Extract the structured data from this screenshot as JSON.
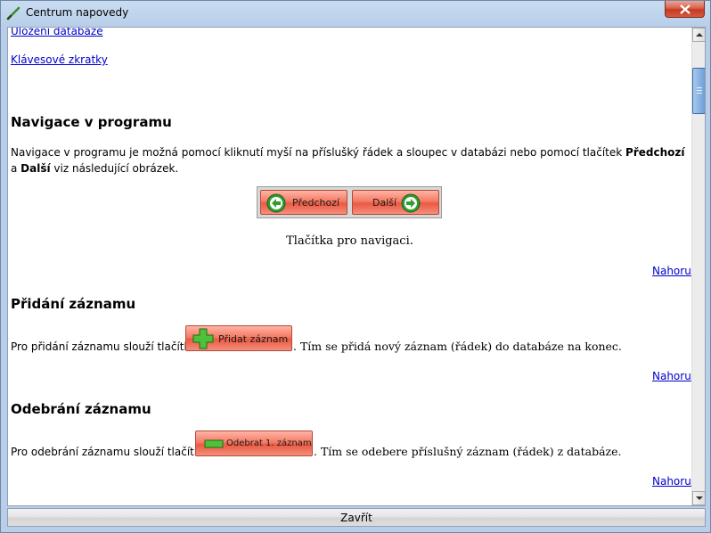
{
  "window": {
    "title": "Centrum napovedy",
    "close_glyph": "✕"
  },
  "links": {
    "database_save": "Uložení databáze",
    "shortcuts": "Klávesové zkratky",
    "top_label": "Nahoru"
  },
  "sections": {
    "navigation": {
      "heading": "Navigace v programu",
      "text_before": "Navigace v programu je možná pomocí kliknutí myší na příslušký řádek a sloupec v databázi nebo pomocí tlačítek ",
      "bold_prev": "Předchozí",
      "text_and": " a ",
      "bold_next": "Další",
      "text_after": " viz následující obrázek.",
      "button_prev": "Předchozí",
      "button_next": "Další",
      "caption": "Tlačítka pro navigaci."
    },
    "add_record": {
      "heading": "Přidání záznamu",
      "text_before": "Pro přidání záznamu slouží tlačítko",
      "button": "Přidat záznam",
      "text_after": ". Tím se přidá nový záznam (řádek) do databáze na konec."
    },
    "remove_record": {
      "heading": "Odebrání záznamu",
      "text_before": "Pro odebrání záznamu slouží tlačítko",
      "button": "Odebrat 1. záznam",
      "text_after": ". Tím se odebere příslušný záznam (řádek) z databáze."
    }
  },
  "footer": {
    "close_label": "Zavřít"
  },
  "colors": {
    "link": "#0000cc",
    "button_red": "#ea5a43",
    "icon_green": "#2e9e2e"
  }
}
